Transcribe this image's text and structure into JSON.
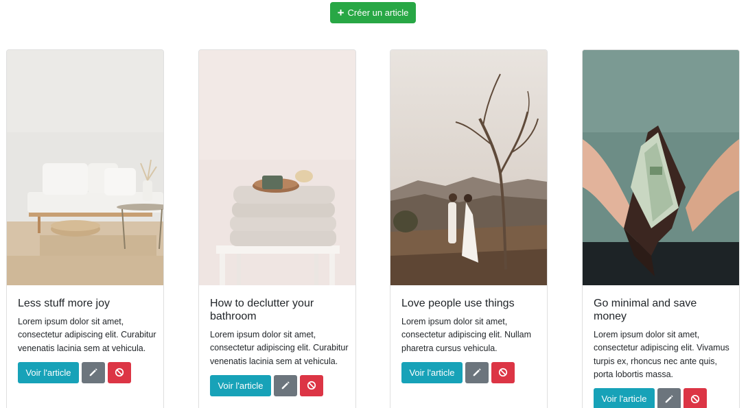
{
  "header": {
    "create_button": {
      "icon": "plus-icon",
      "label": "Créer un article"
    }
  },
  "colors": {
    "success": "#28a745",
    "info": "#17a2b8",
    "secondary": "#6c757d",
    "danger": "#dc3545"
  },
  "articles": [
    {
      "image": "living-room-sofa",
      "title": "Less stuff more joy",
      "text": "Lorem ipsum dolor sit amet, consectetur adipiscing elit. Curabitur venenatis lacinia sem at vehicula.",
      "view_label": "Voir l'article",
      "edit_icon": "pencil-icon",
      "delete_icon": "ban-icon"
    },
    {
      "image": "folded-towels-soap",
      "title": "How to declutter your bathroom",
      "text": "Lorem ipsum dolor sit amet, consectetur adipiscing elit. Curabitur venenatis lacinia sem at vehicula.",
      "view_label": "Voir l'article",
      "edit_icon": "pencil-icon",
      "delete_icon": "ban-icon"
    },
    {
      "image": "couple-under-tree",
      "title": "Love people use things",
      "text": "Lorem ipsum dolor sit amet, consectetur adipiscing elit. Nullam pharetra cursus vehicula.",
      "view_label": "Voir l'article",
      "edit_icon": "pencil-icon",
      "delete_icon": "ban-icon"
    },
    {
      "image": "wallet-with-cash",
      "title": "Go minimal and save money",
      "text": "Lorem ipsum dolor sit amet, consectetur adipiscing elit. Vivamus turpis ex, rhoncus nec ante quis, porta lobortis massa.",
      "view_label": "Voir l'article",
      "edit_icon": "pencil-icon",
      "delete_icon": "ban-icon"
    }
  ]
}
